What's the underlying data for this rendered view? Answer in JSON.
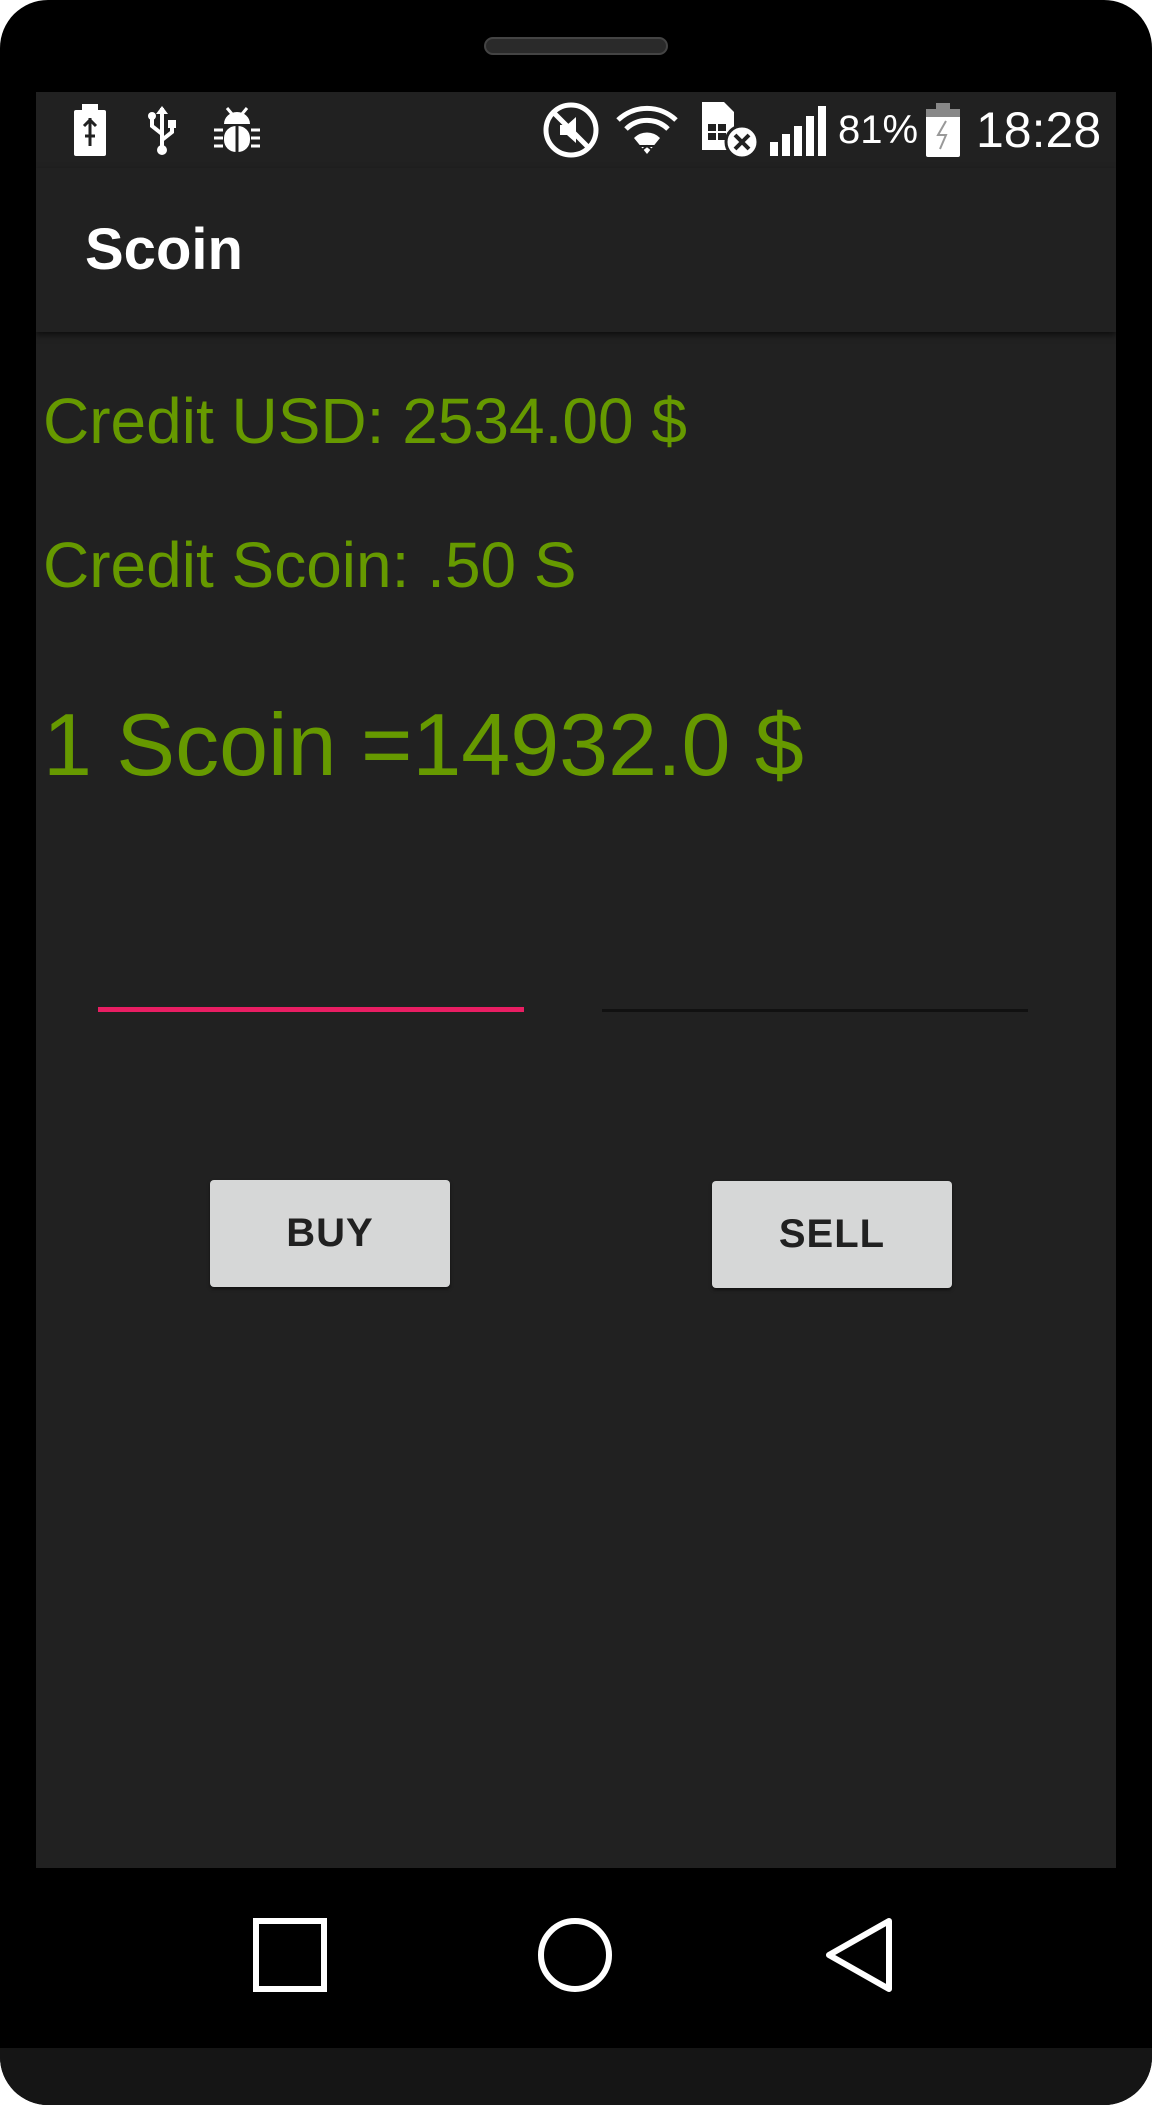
{
  "status_bar": {
    "battery_percent": "81%",
    "time": "18:28",
    "icons": [
      "battery-charging-icon",
      "usb-icon",
      "debug-bug-icon",
      "muted-icon",
      "wifi-icon",
      "sim-error-icon",
      "signal-icon",
      "battery-icon"
    ]
  },
  "app_bar": {
    "title": "Scoin"
  },
  "main": {
    "credit_usd": "Credit USD: 2534.00 $",
    "credit_scoin": "Credit Scoin: .50 S",
    "exchange_rate": "1 Scoin =14932.0 $",
    "input_left": {
      "value": "",
      "placeholder": ""
    },
    "input_right": {
      "value": "",
      "placeholder": ""
    },
    "buy_label": "BUY",
    "sell_label": "SELL"
  },
  "nav_bar": {
    "icons": [
      "recents-square-icon",
      "home-circle-icon",
      "back-triangle-icon"
    ]
  },
  "colors": {
    "accent_green": "#669900",
    "focus_pink": "#e91e63",
    "background": "#212121",
    "button": "#d6d7d7"
  }
}
